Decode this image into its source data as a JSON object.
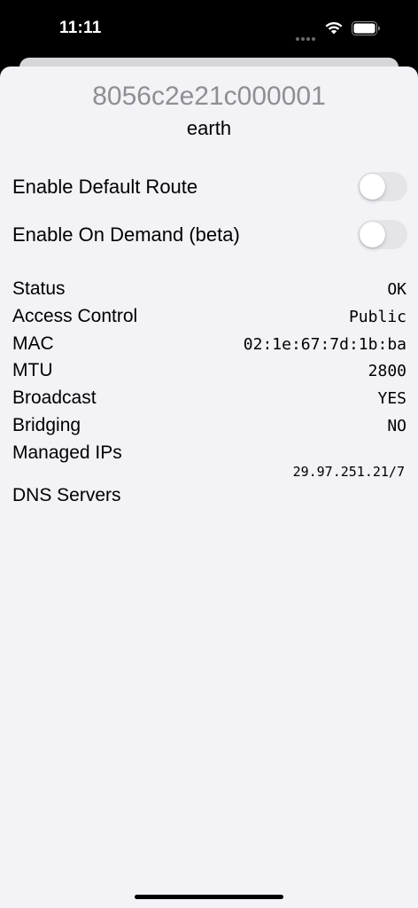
{
  "status_bar": {
    "time": "11:11",
    "wifi_icon": "wifi-icon",
    "battery_icon": "battery-icon"
  },
  "header": {
    "network_id": "8056c2e21c000001",
    "network_name": "earth"
  },
  "toggles": [
    {
      "label": "Enable Default Route",
      "on": false
    },
    {
      "label": "Enable On Demand (beta)",
      "on": false
    }
  ],
  "details": {
    "status": {
      "label": "Status",
      "value": "OK"
    },
    "access_control": {
      "label": "Access Control",
      "value": "Public"
    },
    "mac": {
      "label": "MAC",
      "value": "02:1e:67:7d:1b:ba"
    },
    "mtu": {
      "label": "MTU",
      "value": "2800"
    },
    "broadcast": {
      "label": "Broadcast",
      "value": "YES"
    },
    "bridging": {
      "label": "Bridging",
      "value": "NO"
    },
    "managed_ips": {
      "label": "Managed IPs",
      "values": [
        "29.97.251.21/7"
      ]
    },
    "dns_servers": {
      "label": "DNS Servers"
    }
  },
  "colors": {
    "sheet_background": "#f2f2f7",
    "secondary_text": "#8e8e93",
    "toggle_off": "#e4e4e9"
  }
}
